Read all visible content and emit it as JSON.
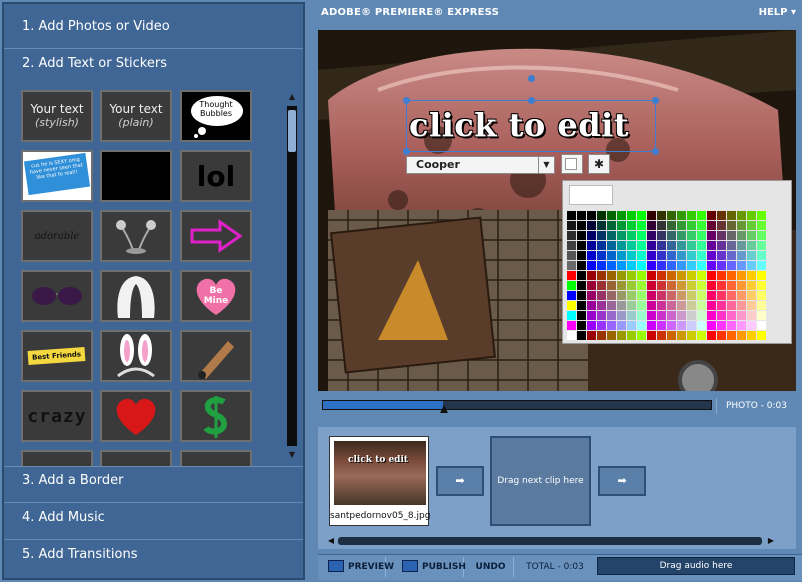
{
  "app": {
    "title": "ADOBE® PREMIERE® EXPRESS",
    "help": "HELP",
    "help_arrow": "▾"
  },
  "steps": [
    {
      "label": "1.  Add Photos or Video"
    },
    {
      "label": "2.  Add Text or Stickers"
    },
    {
      "label": "3.  Add a Border"
    },
    {
      "label": "4.  Add Music"
    },
    {
      "label": "5.  Add Transitions"
    }
  ],
  "stickers": {
    "text_styles": [
      {
        "line1": "Your text",
        "line2": "(stylish)"
      },
      {
        "line1": "Your text",
        "line2": "(plain)"
      }
    ],
    "thought_bubble": "Thought Bubbles",
    "speech_bubble": "cus he is SEXY omg have never seen that like that fo real!!",
    "lol": "lol",
    "adorable": "adorable",
    "be_mine": "Be Mine",
    "best_friends": "Best Friends",
    "crazy": "crazy",
    "icons": [
      "eye-stalk-icon",
      "arrow-icon",
      "sunglasses-icon",
      "veil-icon",
      "heart-candy-icon",
      "bunny-ears-icon",
      "cigar-icon",
      "heart-icon",
      "dollar-icon"
    ]
  },
  "scroll": {
    "up": "▲",
    "down": "▼"
  },
  "editor": {
    "overlay_text": "click to edit",
    "font": "Cooper",
    "font_arrow": "▼",
    "settings_glyph": "✱",
    "selected_color": "#ffffff"
  },
  "timeline": {
    "progress": 0.31,
    "photo_time": "PHOTO - 0:03"
  },
  "clips": {
    "clip_name": "santpedornov05_8.jpg",
    "clip_overlay": "click to edit",
    "drag_next": "Drag next clip here",
    "arrow_glyph": "➡"
  },
  "strip_scroll": {
    "left": "◀",
    "right": "▶"
  },
  "toolbar": {
    "preview": "PREVIEW",
    "publish": "PUBLISH",
    "undo": "UNDO",
    "total": "TOTAL - 0:03",
    "drag_audio": "Drag audio here"
  },
  "colors": {
    "panel": "#3f6694",
    "accent": "#2e70c4",
    "background": "#5f88b4"
  }
}
